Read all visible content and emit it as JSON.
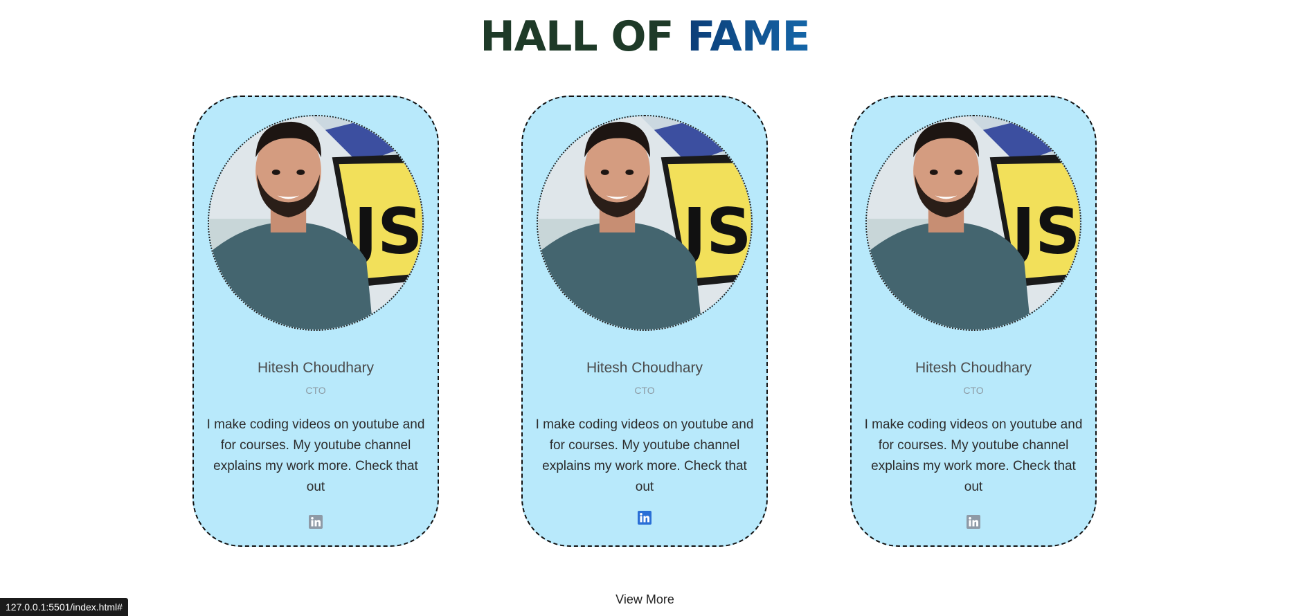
{
  "heading": {
    "part1": "HALL OF",
    "part2": "FAME"
  },
  "cards": [
    {
      "name": "Hitesh Choudhary",
      "role": "CTO",
      "description": "I make coding videos on youtube and for courses. My youtube channel explains my work more. Check that out",
      "photo_sign": "JS",
      "social_icon": "linkedin-icon",
      "social_color": "#8e9aa6"
    },
    {
      "name": "Hitesh Choudhary",
      "role": "CTO",
      "description": "I make coding videos on youtube and for courses. My youtube channel explains my work more. Check that out",
      "photo_sign": "JS",
      "social_icon": "linkedin-icon",
      "social_color": "#2a6fd6"
    },
    {
      "name": "Hitesh Choudhary",
      "role": "CTO",
      "description": "I make coding videos on youtube and for courses. My youtube channel explains my work more. Check that out",
      "photo_sign": "JS",
      "social_icon": "linkedin-icon",
      "social_color": "#8e9aa6"
    }
  ],
  "view_more_label": "View More",
  "status_url": "127.0.0.1:5501/index.html#",
  "colors": {
    "card_bg": "#b8e9fb",
    "heading_dark": "#1e3a28",
    "heading_blue": "#0b3d77"
  }
}
